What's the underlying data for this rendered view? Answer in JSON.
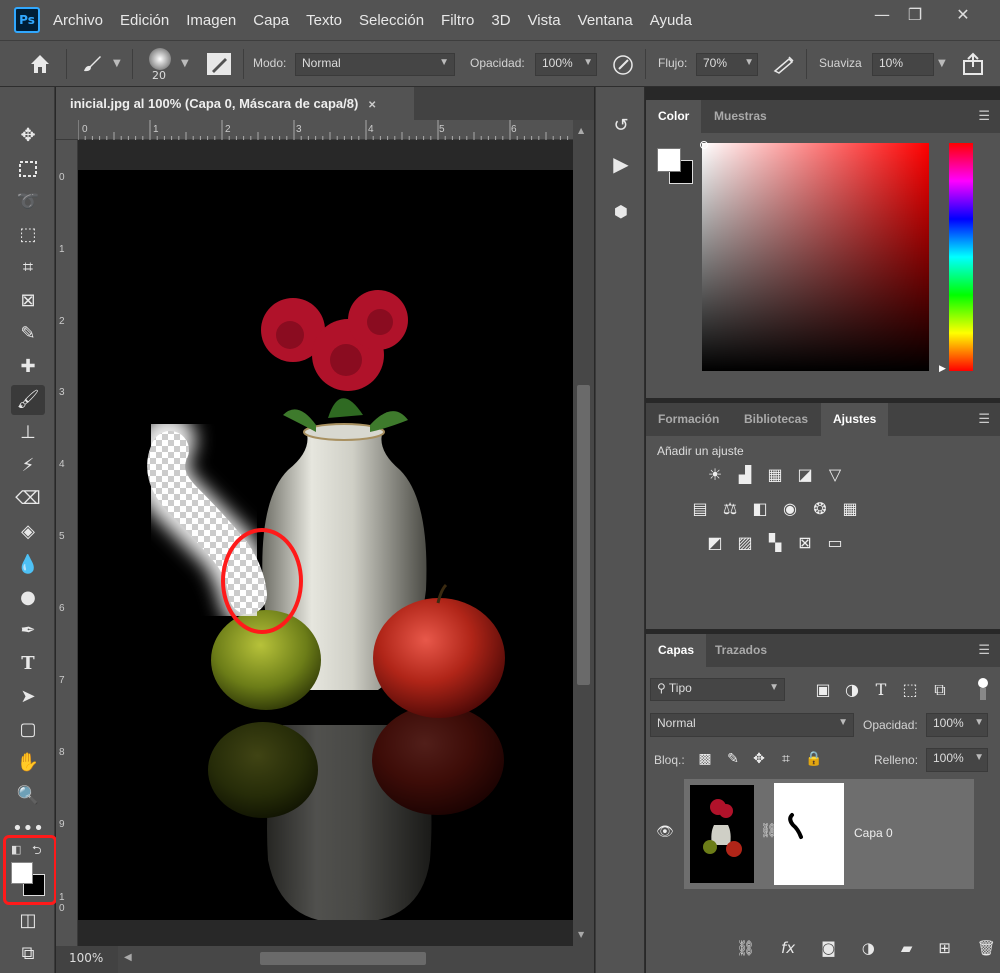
{
  "app": {
    "logo": "Ps"
  },
  "menu": [
    "Archivo",
    "Edición",
    "Imagen",
    "Capa",
    "Texto",
    "Selección",
    "Filtro",
    "3D",
    "Vista",
    "Ventana",
    "Ayuda"
  ],
  "window_controls": {
    "minimize": "—",
    "restore": "❐",
    "close": "✕"
  },
  "options": {
    "brush_size": "20",
    "mode_label": "Modo:",
    "mode_value": "Normal",
    "opacity_label": "Opacidad:",
    "opacity_value": "100%",
    "flow_label": "Flujo:",
    "flow_value": "70%",
    "smooth_label": "Suaviza",
    "smooth_value": "10%"
  },
  "document": {
    "tab_title": "inicial.jpg al 100% (Capa 0, Máscara de capa/8)",
    "tab_close": "✕",
    "zoom": "100%",
    "ruler_h": [
      "0",
      "1",
      "2",
      "3",
      "4",
      "5",
      "6"
    ],
    "ruler_v": [
      "0",
      "1",
      "2",
      "3",
      "4",
      "5",
      "6",
      "7",
      "8",
      "9",
      "1\n0"
    ]
  },
  "color_panel": {
    "tabs": [
      "Color",
      "Muestras"
    ],
    "active_tab": "Color",
    "foreground": "#ffffff",
    "background": "#000000",
    "hue_base": "#ff0000"
  },
  "adjustments_panel": {
    "tabs": [
      "Formación",
      "Bibliotecas",
      "Ajustes"
    ],
    "active_tab": "Ajustes",
    "heading": "Añadir un ajuste"
  },
  "layers_panel": {
    "tabs": [
      "Capas",
      "Trazados"
    ],
    "active_tab": "Capas",
    "filter_label": "Tipo",
    "blend_mode": "Normal",
    "opacity_label": "Opacidad:",
    "opacity_value": "100%",
    "lock_label": "Bloq.:",
    "fill_label": "Relleno:",
    "fill_value": "100%",
    "layers": [
      {
        "name": "Capa 0",
        "visible": true,
        "has_mask": true
      }
    ]
  },
  "highlight_color": "#ff1a1a"
}
